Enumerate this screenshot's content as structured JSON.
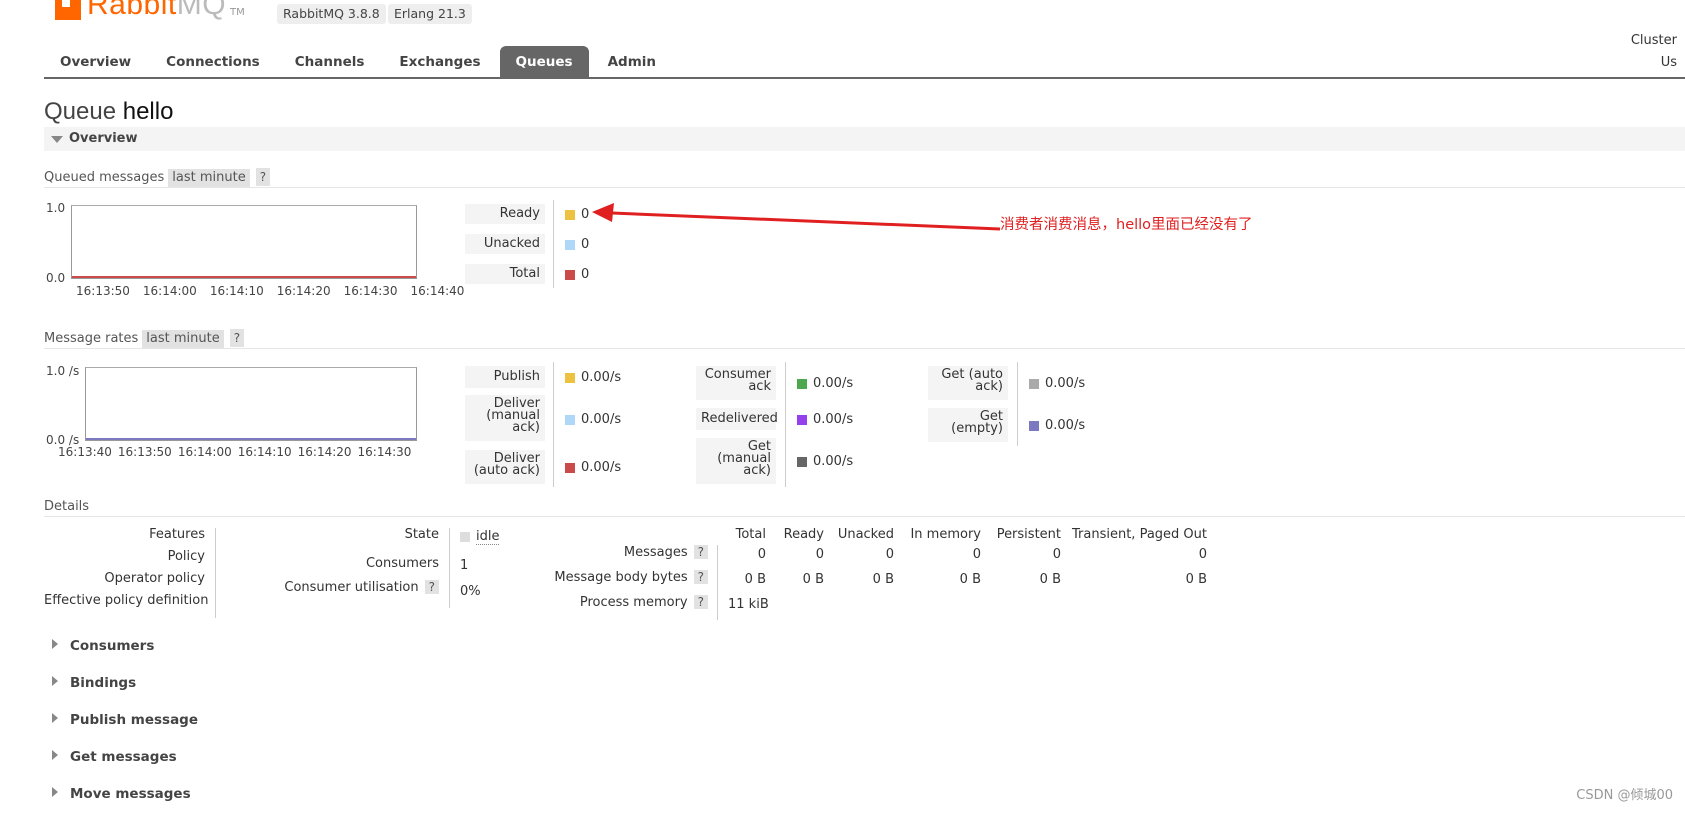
{
  "header": {
    "logo_main": "Rabbit",
    "logo_mq": "MQ",
    "logo_tm": "TM",
    "version_badge": "RabbitMQ 3.8.8",
    "erlang_badge": "Erlang 21.3",
    "cluster_label": "Cluster",
    "user_label": "Us"
  },
  "tabs": [
    {
      "label": "Overview",
      "active": false
    },
    {
      "label": "Connections",
      "active": false
    },
    {
      "label": "Channels",
      "active": false
    },
    {
      "label": "Exchanges",
      "active": false
    },
    {
      "label": "Queues",
      "active": true
    },
    {
      "label": "Admin",
      "active": false
    }
  ],
  "page": {
    "title_prefix": "Queue",
    "queue_name": "hello",
    "overview_section": "Overview"
  },
  "queued_messages": {
    "label": "Queued messages",
    "range": "last minute",
    "help": "?",
    "y_max": "1.0",
    "y_min": "0.0",
    "x_ticks": [
      "16:13:50",
      "16:14:00",
      "16:14:10",
      "16:14:20",
      "16:14:30",
      "16:14:40"
    ],
    "legend": [
      {
        "label": "Ready",
        "value": "0",
        "color": "#edc240"
      },
      {
        "label": "Unacked",
        "value": "0",
        "color": "#afd8f8"
      },
      {
        "label": "Total",
        "value": "0",
        "color": "#cb4b4b"
      }
    ]
  },
  "annotation": "消费者消费消息，hello里面已经没有了",
  "message_rates": {
    "label": "Message rates",
    "range": "last minute",
    "help": "?",
    "y_max": "1.0 /s",
    "y_min": "0.0 /s",
    "x_ticks": [
      "16:13:40",
      "16:13:50",
      "16:14:00",
      "16:14:10",
      "16:14:20",
      "16:14:30"
    ],
    "col1": [
      {
        "label": "Publish",
        "value": "0.00/s",
        "color": "#edc240"
      },
      {
        "label": "Deliver (manual ack)",
        "value": "0.00/s",
        "color": "#afd8f8"
      },
      {
        "label": "Deliver (auto ack)",
        "value": "0.00/s",
        "color": "#cb4b4b"
      }
    ],
    "col2": [
      {
        "label": "Consumer ack",
        "value": "0.00/s",
        "color": "#4da74d"
      },
      {
        "label": "Redelivered",
        "value": "0.00/s",
        "color": "#9440ed"
      },
      {
        "label": "Get (manual ack)",
        "value": "0.00/s",
        "color": "#666666"
      }
    ],
    "col3": [
      {
        "label": "Get (auto ack)",
        "value": "0.00/s",
        "color": "#aaaaaa"
      },
      {
        "label": "Get (empty)",
        "value": "0.00/s",
        "color": "#7c79c0"
      }
    ]
  },
  "details": {
    "label": "Details",
    "features": "Features",
    "policy": "Policy",
    "operator_policy": "Operator policy",
    "effective_policy": "Effective policy definition",
    "state_label": "State",
    "state_value": "idle",
    "consumers_label": "Consumers",
    "consumers_value": "1",
    "utilisation_label": "Consumer utilisation",
    "utilisation_help": "?",
    "utilisation_value": "0%",
    "columns": [
      "Total",
      "Ready",
      "Unacked",
      "In memory",
      "Persistent",
      "Transient, Paged Out"
    ],
    "messages_label": "Messages",
    "messages_help": "?",
    "messages_values": [
      "0",
      "0",
      "0",
      "0",
      "0",
      "0"
    ],
    "body_bytes_label": "Message body bytes",
    "body_bytes_help": "?",
    "body_bytes_values": [
      "0 B",
      "0 B",
      "0 B",
      "0 B",
      "0 B",
      "0 B"
    ],
    "process_memory_label": "Process memory",
    "process_memory_help": "?",
    "process_memory_value": "11 kiB"
  },
  "collapsed_sections": [
    "Consumers",
    "Bindings",
    "Publish message",
    "Get messages",
    "Move messages"
  ],
  "watermark": "CSDN @倾城00"
}
